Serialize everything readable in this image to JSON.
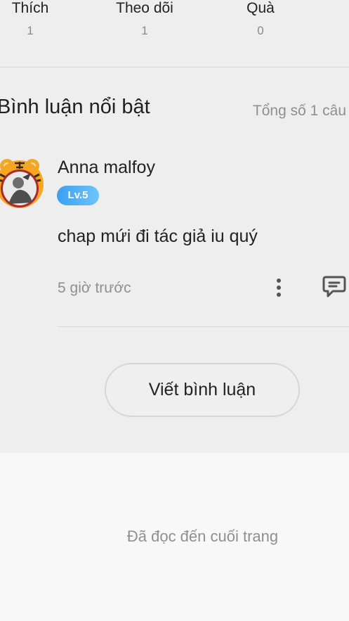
{
  "stats": [
    {
      "label": "Thích",
      "value": "1"
    },
    {
      "label": "Theo dõi",
      "value": "1"
    },
    {
      "label": "Quà",
      "value": "0"
    }
  ],
  "comments_section": {
    "title": "Bình luận nổi bật",
    "total": "Tổng số 1 câu"
  },
  "comment": {
    "username": "Anna malfoy",
    "level": "Lv.5",
    "text": "chap mứi đi tác giả iu quý",
    "time": "5 giờ trước",
    "icons": {
      "more": "more-vertical-icon",
      "reply": "comment-bubble-icon",
      "avatar_frame": "tiger-frame"
    }
  },
  "write_button": {
    "label": "Viết bình luận"
  },
  "footer": {
    "end_text": "Đã đọc đến cuối trang"
  },
  "colors": {
    "level_badge": "#3aa0f0",
    "background": "#eeeeee",
    "footer_bg": "#f8f8f8",
    "muted_text": "#8f8f8f"
  }
}
